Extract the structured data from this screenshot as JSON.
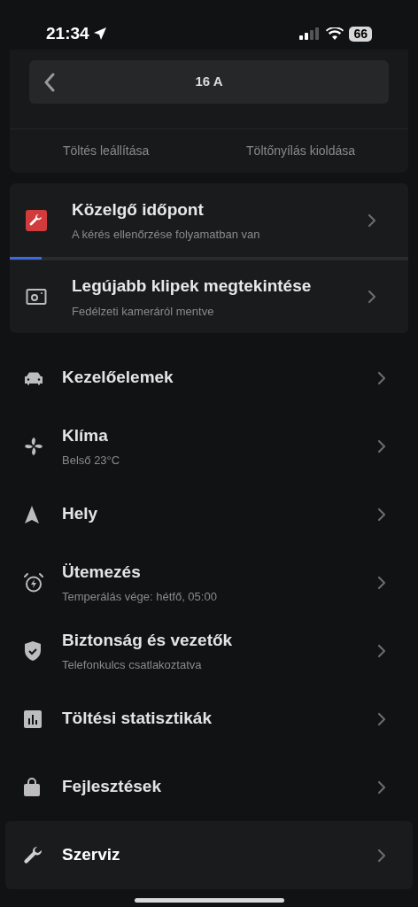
{
  "status_bar": {
    "time": "21:34",
    "battery": "66"
  },
  "charge_card": {
    "amps": "16 A",
    "actions": [
      "Töltés leállítása",
      "Töltőnyílás kioldása"
    ]
  },
  "info_card": {
    "rows": [
      {
        "title": "Közelgő időpont",
        "subtitle": "A kérés ellenőrzése folyamatban van",
        "level": 0.08
      },
      {
        "title": "Legújabb klipek megtekintése",
        "subtitle": "Fedélzeti kameráról mentve"
      }
    ]
  },
  "menu": [
    {
      "title": "Kezelőelemek",
      "selected": false
    },
    {
      "title": "Klíma",
      "subtitle": "Belső 23°C",
      "selected": false
    },
    {
      "title": "Hely",
      "selected": false
    },
    {
      "title": "Ütemezés",
      "subtitle": "Temperálás vége: hétfő, 05:00",
      "selected": false
    },
    {
      "title": "Biztonság és vezetők",
      "subtitle": "Telefonkulcs csatlakoztatva",
      "selected": false
    },
    {
      "title": "Töltési statisztikák",
      "selected": false
    },
    {
      "title": "Fejlesztések",
      "selected": false
    },
    {
      "title": "Szerviz",
      "selected": true
    }
  ]
}
